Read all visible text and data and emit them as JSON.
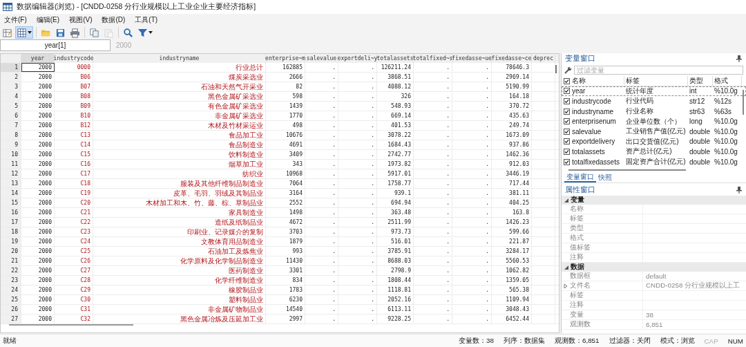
{
  "window": {
    "title": "数据编辑器(浏览) - [CNDD-0258 分行业规模以上工业企业主要经济指标]"
  },
  "menu": [
    "文件(F)",
    "编辑(E)",
    "视图(V)",
    "数据(D)",
    "工具(T)"
  ],
  "toolbar": [
    {
      "kind": "edit",
      "selected": false,
      "disabled": false,
      "dropdown": false
    },
    {
      "kind": "browse",
      "selected": true,
      "disabled": false,
      "dropdown": true
    },
    {
      "kind": "open",
      "selected": false,
      "disabled": false,
      "dropdown": false
    },
    {
      "kind": "save",
      "selected": false,
      "disabled": false,
      "dropdown": false
    },
    {
      "kind": "print",
      "selected": false,
      "disabled": false,
      "dropdown": false
    },
    {
      "kind": "copy",
      "selected": false,
      "disabled": false,
      "dropdown": false
    },
    {
      "kind": "paste",
      "selected": false,
      "disabled": true,
      "dropdown": false
    },
    {
      "kind": "search",
      "selected": false,
      "disabled": false,
      "dropdown": false
    },
    {
      "kind": "filter",
      "selected": false,
      "disabled": false,
      "dropdown": true
    }
  ],
  "cell_bar": {
    "reference": "year[1]",
    "value": "2000"
  },
  "table": {
    "columns": [
      {
        "label": "year",
        "selected": true
      },
      {
        "label": "industrycode",
        "selected": false
      },
      {
        "label": "industryname",
        "selected": false
      },
      {
        "label": "enterprise~m",
        "selected": false
      },
      {
        "label": "salevalue",
        "selected": false
      },
      {
        "label": "exportdeli~y",
        "selected": false
      },
      {
        "label": "totalassets",
        "selected": false
      },
      {
        "label": "totalfixed~s",
        "selected": false
      },
      {
        "label": "fixedasse~ue",
        "selected": false
      },
      {
        "label": "fixedasse~ce",
        "selected": false
      },
      {
        "label": "deprec",
        "selected": false
      }
    ],
    "rows": [
      {
        "number": "1",
        "selected": true,
        "cells": [
          "2000",
          "0000",
          "行业总计",
          "162885",
          ".",
          ".",
          "126211.24",
          ".",
          ".",
          "78646.3"
        ]
      },
      {
        "number": "2",
        "selected": false,
        "cells": [
          "2000",
          "B06",
          "煤炭采选业",
          "2666",
          ".",
          ".",
          "3868.51",
          ".",
          ".",
          "2969.14"
        ]
      },
      {
        "number": "3",
        "selected": false,
        "cells": [
          "2000",
          "B07",
          "石油和天然气开采业",
          "82",
          ".",
          ".",
          "4088.12",
          ".",
          ".",
          "5190.99"
        ]
      },
      {
        "number": "4",
        "selected": false,
        "cells": [
          "2000",
          "B08",
          "黑色金属矿采选业",
          "598",
          ".",
          ".",
          "326",
          ".",
          ".",
          "164.18"
        ]
      },
      {
        "number": "5",
        "selected": false,
        "cells": [
          "2000",
          "B09",
          "有色金属矿采选业",
          "1439",
          ".",
          ".",
          "548.93",
          ".",
          ".",
          "370.72"
        ]
      },
      {
        "number": "6",
        "selected": false,
        "cells": [
          "2000",
          "B10",
          "非金属矿采选业",
          "1770",
          ".",
          ".",
          "669.14",
          ".",
          ".",
          "435.63"
        ]
      },
      {
        "number": "7",
        "selected": false,
        "cells": [
          "2000",
          "B12",
          "木材及竹材采运业",
          "498",
          ".",
          ".",
          "401.53",
          ".",
          ".",
          "249.74"
        ]
      },
      {
        "number": "8",
        "selected": false,
        "cells": [
          "2000",
          "C13",
          "食品加工业",
          "10676",
          ".",
          ".",
          "3078.22",
          ".",
          ".",
          "1673.09"
        ]
      },
      {
        "number": "9",
        "selected": false,
        "cells": [
          "2000",
          "C14",
          "食品制造业",
          "4691",
          ".",
          ".",
          "1684.43",
          ".",
          ".",
          "937.86"
        ]
      },
      {
        "number": "10",
        "selected": false,
        "cells": [
          "2000",
          "C15",
          "饮料制造业",
          "3409",
          ".",
          ".",
          "2742.77",
          ".",
          ".",
          "1462.36"
        ]
      },
      {
        "number": "11",
        "selected": false,
        "cells": [
          "2000",
          "C16",
          "烟草加工业",
          "343",
          ".",
          ".",
          "1973.82",
          ".",
          ".",
          "912.03"
        ]
      },
      {
        "number": "12",
        "selected": false,
        "cells": [
          "2000",
          "C17",
          "纺织业",
          "10968",
          ".",
          ".",
          "5917.01",
          ".",
          ".",
          "3446.19"
        ]
      },
      {
        "number": "13",
        "selected": false,
        "cells": [
          "2000",
          "C18",
          "服装及其他纤维制品制造业",
          "7064",
          ".",
          ".",
          "1758.77",
          ".",
          ".",
          "717.44"
        ]
      },
      {
        "number": "14",
        "selected": false,
        "cells": [
          "2000",
          "C19",
          "皮革、毛羽、羽绒及其制品业",
          "3164",
          ".",
          ".",
          "939.1",
          ".",
          ".",
          "381.11"
        ]
      },
      {
        "number": "15",
        "selected": false,
        "cells": [
          "2000",
          "C20",
          "木材加工和木、竹、藤、棕、草制品业",
          "2552",
          ".",
          ".",
          "694.94",
          ".",
          ".",
          "404.25"
        ]
      },
      {
        "number": "16",
        "selected": false,
        "cells": [
          "2000",
          "C21",
          "家具制造业",
          "1498",
          ".",
          ".",
          "363.48",
          ".",
          ".",
          "163.8"
        ]
      },
      {
        "number": "17",
        "selected": false,
        "cells": [
          "2000",
          "C22",
          "造纸及纸制品业",
          "4672",
          ".",
          ".",
          "2511.99",
          ".",
          ".",
          "1426.23"
        ]
      },
      {
        "number": "18",
        "selected": false,
        "cells": [
          "2000",
          "C23",
          "印刷业、记录媒介的复制",
          "3703",
          ".",
          ".",
          "973.73",
          ".",
          ".",
          "599.66"
        ]
      },
      {
        "number": "19",
        "selected": false,
        "cells": [
          "2000",
          "C24",
          "文教体育用品制造业",
          "1879",
          ".",
          ".",
          "516.01",
          ".",
          ".",
          "221.87"
        ]
      },
      {
        "number": "20",
        "selected": false,
        "cells": [
          "2000",
          "C25",
          "石油加工及炼焦业",
          "993",
          ".",
          ".",
          "3785.91",
          ".",
          ".",
          "3284.17"
        ]
      },
      {
        "number": "21",
        "selected": false,
        "cells": [
          "2000",
          "C26",
          "化学原料及化学制品制造业",
          "11430",
          ".",
          ".",
          "8688.03",
          ".",
          ".",
          "5560.53"
        ]
      },
      {
        "number": "22",
        "selected": false,
        "cells": [
          "2000",
          "C27",
          "医药制造业",
          "3301",
          ".",
          ".",
          "2798.9",
          ".",
          ".",
          "1062.82"
        ]
      },
      {
        "number": "23",
        "selected": false,
        "cells": [
          "2000",
          "C28",
          "化学纤维制造业",
          "834",
          ".",
          ".",
          "1808.44",
          ".",
          ".",
          "1359.05"
        ]
      },
      {
        "number": "24",
        "selected": false,
        "cells": [
          "2000",
          "C29",
          "橡胶制品业",
          "1783",
          ".",
          ".",
          "1118.81",
          ".",
          ".",
          "565.38"
        ]
      },
      {
        "number": "25",
        "selected": false,
        "cells": [
          "2000",
          "C30",
          "塑料制品业",
          "6230",
          ".",
          ".",
          "2052.16",
          ".",
          ".",
          "1109.94"
        ]
      },
      {
        "number": "26",
        "selected": false,
        "cells": [
          "2000",
          "C31",
          "非金属矿物制品业",
          "14540",
          ".",
          ".",
          "6113.11",
          ".",
          ".",
          "3048.43"
        ]
      },
      {
        "number": "27",
        "selected": false,
        "cells": [
          "2000",
          "C32",
          "黑色金属冶炼及压延加工业",
          "2997",
          ".",
          ".",
          "9228.25",
          ".",
          ".",
          "6452.44"
        ]
      }
    ]
  },
  "variables_window": {
    "title": "变量窗口",
    "filter_placeholder": "过滤变量",
    "all_checked": true,
    "columns": [
      "名称",
      "标签",
      "类型",
      "格式"
    ],
    "rows": [
      {
        "checked": true,
        "selected": true,
        "name": "year",
        "label": "统计年度",
        "type": "int",
        "format": "%10.0g"
      },
      {
        "checked": true,
        "selected": false,
        "name": "industrycode",
        "label": "行业代码",
        "type": "str12",
        "format": "%12s"
      },
      {
        "checked": true,
        "selected": false,
        "name": "industryname",
        "label": "行业名称",
        "type": "str63",
        "format": "%63s"
      },
      {
        "checked": true,
        "selected": false,
        "name": "enterprisenum",
        "label": "企业单位数（个）",
        "type": "long",
        "format": "%10.0g"
      },
      {
        "checked": true,
        "selected": false,
        "name": "salevalue",
        "label": "工业销售产值(亿元)",
        "type": "double",
        "format": "%10.0g"
      },
      {
        "checked": true,
        "selected": false,
        "name": "exportdelivery",
        "label": "出口交货值(亿元)",
        "type": "double",
        "format": "%10.0g"
      },
      {
        "checked": true,
        "selected": false,
        "name": "totalassets",
        "label": "资产总计(亿元)",
        "type": "double",
        "format": "%10.0g"
      },
      {
        "checked": true,
        "selected": false,
        "name": "totalfixedassets",
        "label": "固定资产合计(亿元)",
        "type": "double",
        "format": "%10.0g"
      }
    ]
  },
  "panel_tabs": [
    {
      "label": "变量窗口",
      "selected": true
    },
    {
      "label": "快照",
      "selected": false
    }
  ],
  "properties_window": {
    "title": "属性窗口",
    "groups": [
      {
        "label": "变量",
        "expanded": true,
        "rows": [
          {
            "name": "名称"
          },
          {
            "name": "标签"
          },
          {
            "name": "类型"
          },
          {
            "name": "格式"
          },
          {
            "name": "值标签"
          },
          {
            "name": "注释"
          }
        ]
      },
      {
        "label": "数据",
        "expanded": true,
        "rows": [
          {
            "name": "数据框",
            "value": "default"
          },
          {
            "name": "文件名",
            "value": "CNDD-0258 分行业规模以上工",
            "expanded": false
          },
          {
            "name": "标签"
          },
          {
            "name": "注释"
          },
          {
            "name": "变量",
            "value": "38"
          },
          {
            "name": "观测数",
            "value": "6,851"
          }
        ]
      }
    ]
  },
  "status_bar": {
    "message": "就绪",
    "items": [
      "变量数：38",
      "列序：数据集",
      "观测数：6,851",
      "过滤器：关闭",
      "模式：浏览"
    ],
    "indicators": [
      {
        "label": "CAP",
        "on": false
      },
      {
        "label": "NUM",
        "on": true
      }
    ]
  }
}
